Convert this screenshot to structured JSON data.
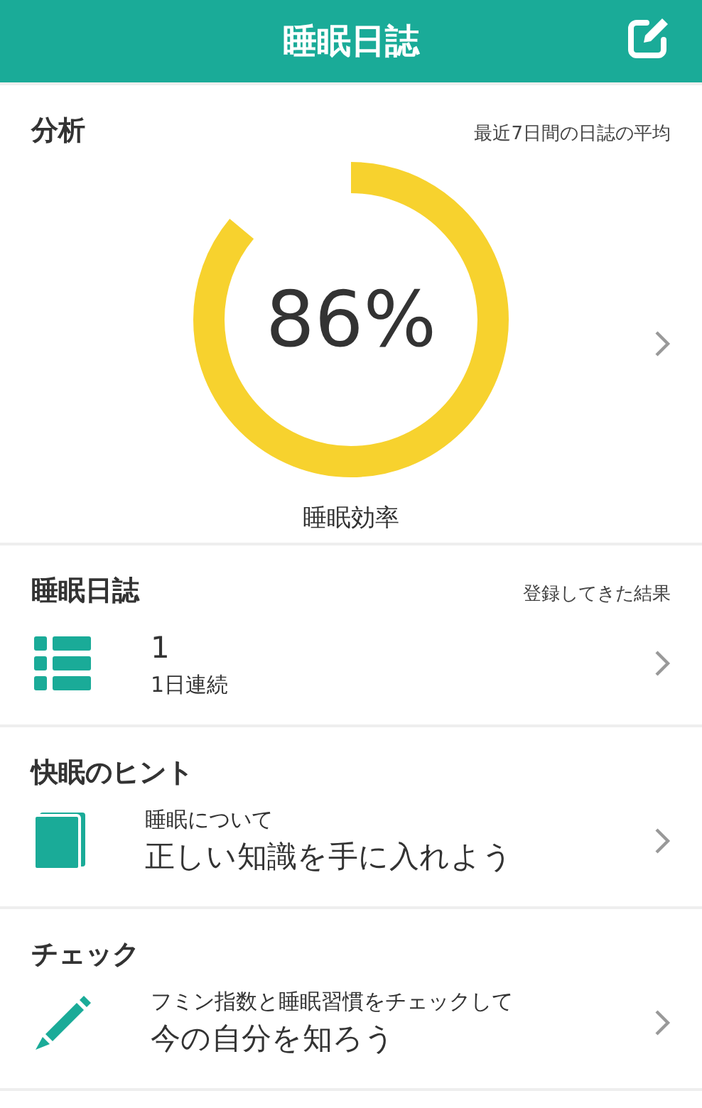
{
  "header": {
    "title": "睡眠日誌"
  },
  "analysis": {
    "title": "分析",
    "note": "最近7日間の日誌の平均",
    "value": "86%",
    "level": 0.86,
    "label": "睡眠効率"
  },
  "cards": [
    {
      "kind": "stat",
      "title": "睡眠日誌",
      "note": "登録してきた結果",
      "line_1": "1",
      "line_2": "1日連続"
    },
    {
      "kind": "tip",
      "title": "快眠のヒント",
      "line_1": "睡眠について",
      "line_2": "正しい知識を手に入れよう"
    },
    {
      "kind": "tip",
      "title": "チェック",
      "line_1": "フミン指数と睡眠習慣をチェックして",
      "line_2": "今の自分を知ろう"
    }
  ]
}
